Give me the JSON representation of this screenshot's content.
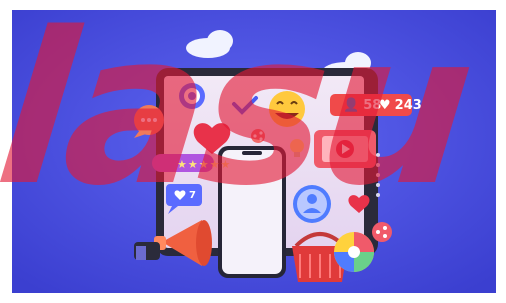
{
  "watermark": {
    "text": "lasu",
    "color": "#e21836"
  },
  "badges": {
    "followers_count": "58",
    "likes_count": "243",
    "notification_count": "7",
    "rating_stars": "★★★★★"
  },
  "colors": {
    "background": "#4a4ee0",
    "tablet_frame": "#2a2a3a",
    "screen": "#efe6f7",
    "phone": "#f5f2fa",
    "heart": "#e8324a",
    "accent_red": "#f04a4a",
    "purple_bubble": "#b055e0",
    "blue_shape": "#5b6bff"
  },
  "icons": [
    "target-icon",
    "check-icon",
    "laughing-emoji-icon",
    "heart-icon",
    "chat-bubble-icon",
    "play-video-icon",
    "user-profile-icon",
    "megaphone-icon",
    "shopping-basket-icon",
    "pie-chart-icon",
    "share-icon",
    "lightbulb-icon",
    "cloud-icon"
  ]
}
